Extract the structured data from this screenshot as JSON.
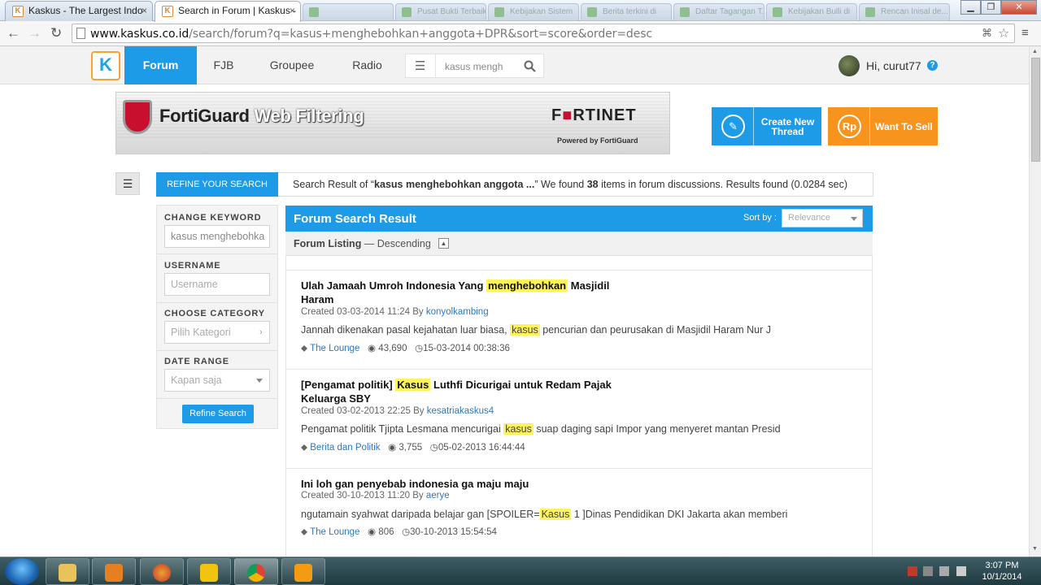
{
  "browser": {
    "tabs": [
      {
        "label": "Kaskus - The Largest Indo",
        "active": false
      },
      {
        "label": "Search in Forum | Kaskus -",
        "active": true
      }
    ],
    "background_tabs": [
      "",
      "Pusat Bukti Terbaik",
      "Kebijakan Sistem",
      "Berita terkini di",
      "Daftar Tagangan T...",
      "Kebijakan Bulli di",
      "Rencan Inisal de..."
    ],
    "url_domain": "www.kaskus.co.id",
    "url_path": "/search/forum?q=kasus+menghebohkan+anggota+DPR&sort=score&order=desc"
  },
  "header": {
    "logo_letter": "K",
    "nav": [
      {
        "label": "Forum",
        "active": true
      },
      {
        "label": "FJB",
        "active": false
      },
      {
        "label": "Groupee",
        "active": false
      },
      {
        "label": "Radio",
        "active": false
      }
    ],
    "search_value": "kasus mengh",
    "greeting": "Hi, curut77"
  },
  "banner": {
    "title_dark": "FortiGuard",
    "title_light": "Web Filtering",
    "brand_pre": "F",
    "brand_mark": "■",
    "brand_post": "RTINET",
    "powered": "Powered by FortiGuard"
  },
  "actions": {
    "create_thread": "Create New Thread",
    "want_to_sell": "Want To Sell",
    "rp": "Rp"
  },
  "refine": {
    "header": "REFINE YOUR SEARCH",
    "result_prefix": "Search Result of “",
    "result_query": "kasus menghebohkan anggota ...",
    "result_mid": "” We found ",
    "result_count": "38",
    "result_suffix": " items in forum discussions. Results found (0.0284 sec)",
    "change_keyword_label": "CHANGE KEYWORD",
    "keyword_value": "kasus menghebohka",
    "username_label": "USERNAME",
    "username_placeholder": "Username",
    "category_label": "CHOOSE CATEGORY",
    "category_placeholder": "Pilih Kategori",
    "date_label": "DATE RANGE",
    "date_placeholder": "Kapan saja",
    "button": "Refine Search"
  },
  "results": {
    "title": "Forum Search Result",
    "sort_label": "Sort by :",
    "sort_value": "Relevance",
    "listing_label": "Forum Listing",
    "listing_order": " — Descending",
    "items": [
      {
        "title_pre": "Ulah Jamaah Umroh Indonesia Yang ",
        "title_hl": "menghebohkan",
        "title_post": " Masjidil Haram",
        "created": "Created 03-03-2014 11:24 By ",
        "author": "konyolkambing",
        "snip_pre": "Jannah dikenakan pasal kejahatan luar biasa, ",
        "snip_hl": "kasus",
        "snip_post": " pencurian dan peurusakan di Masjidil Haram Nur J",
        "forum": "The Lounge",
        "views": "43,690",
        "last": "15-03-2014 00:38:36"
      },
      {
        "title_pre": "[Pengamat politik] ",
        "title_hl": "Kasus",
        "title_post": " Luthfi Dicurigai untuk Redam Pajak Keluarga SBY",
        "created": "Created 03-02-2013 22:25 By ",
        "author": "kesatriakaskus4",
        "snip_pre": "Pengamat politik Tjipta Lesmana mencurigai ",
        "snip_hl": "kasus",
        "snip_post": " suap daging sapi Impor yang menyeret mantan Presid",
        "forum": "Berita dan Politik",
        "views": "3,755",
        "last": "05-02-2013 16:44:44"
      },
      {
        "title_pre": "Ini loh gan penyebab indonesia ga maju maju",
        "title_hl": "",
        "title_post": "",
        "created": "Created 30-10-2013 11:20 By ",
        "author": "aerye",
        "snip_pre": "ngutamain syahwat daripada belajar gan [SPOILER=",
        "snip_hl": "Kasus",
        "snip_post": " 1 ]Dinas Pendidikan DKI Jakarta akan memberi",
        "forum": "The Lounge",
        "views": "806",
        "last": "30-10-2013 15:54:54"
      }
    ]
  },
  "taskbar": {
    "time": "3:07 PM",
    "date": "10/1/2014"
  },
  "colors": {
    "kaskus_blue": "#1e9be6",
    "sell_orange": "#f7941e",
    "highlight": "#fff35c"
  }
}
